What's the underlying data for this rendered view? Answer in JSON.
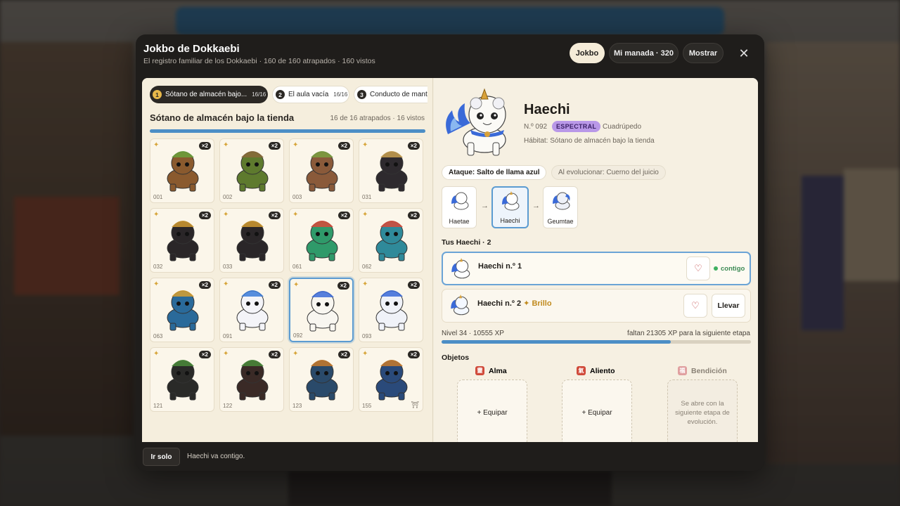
{
  "modal": {
    "title": "Jokbo de Dokkaebi",
    "subtitle": "El registro familiar de los Dokkaebi · 160 de 160 atrapados · 160 vistos",
    "buttons": {
      "jokbo": "Jokbo",
      "manada": "Mi manada · 320",
      "mostrar": "Mostrar"
    },
    "close_icon": "close-icon"
  },
  "tabs": [
    {
      "num": "1",
      "label": "Sótano de almacén bajo...",
      "count": "16/16"
    },
    {
      "num": "2",
      "label": "El aula vacía",
      "count": "16/16"
    },
    {
      "num": "3",
      "label": "Conducto de mant",
      "count": ""
    }
  ],
  "area": {
    "title": "Sótano de almacén bajo la tienda",
    "count": "16 de 16 atrapados · 16 vistos",
    "progress": 1.0
  },
  "creatures": [
    {
      "no": "001",
      "badge": "×2",
      "color": "#8a5a2e",
      "accent": "#6aa13a"
    },
    {
      "no": "002",
      "badge": "×2",
      "color": "#5e7a2e",
      "accent": "#8a6a3a"
    },
    {
      "no": "003",
      "badge": "×2",
      "color": "#8a5a3a",
      "accent": "#7aa040"
    },
    {
      "no": "031",
      "badge": "×2",
      "color": "#2e2a2e",
      "accent": "#c8a050"
    },
    {
      "no": "032",
      "badge": "×2",
      "color": "#2a2628",
      "accent": "#d09a30"
    },
    {
      "no": "033",
      "badge": "×2",
      "color": "#2a2628",
      "accent": "#d09a30"
    },
    {
      "no": "061",
      "badge": "×2",
      "color": "#2f9a6a",
      "accent": "#d84a3a"
    },
    {
      "no": "062",
      "badge": "×2",
      "color": "#2f8a9a",
      "accent": "#d84a3a"
    },
    {
      "no": "063",
      "badge": "×2",
      "color": "#2a6a9a",
      "accent": "#d8a030"
    },
    {
      "no": "091",
      "badge": "×2",
      "color": "#f4f4f8",
      "accent": "#3a7ad8"
    },
    {
      "no": "092",
      "badge": "×2",
      "color": "#f8f6f0",
      "accent": "#3a6ad8"
    },
    {
      "no": "093",
      "badge": "×2",
      "color": "#f0f2f8",
      "accent": "#3a6ad8"
    },
    {
      "no": "121",
      "badge": "×2",
      "color": "#2a2a28",
      "accent": "#4a8a3a"
    },
    {
      "no": "122",
      "badge": "×2",
      "color": "#3a2a26",
      "accent": "#4a8a3a"
    },
    {
      "no": "123",
      "badge": "×2",
      "color": "#2a4a6a",
      "accent": "#c87a2a"
    },
    {
      "no": "155",
      "badge": "×2",
      "color": "#2a4a7a",
      "accent": "#c87a2a",
      "gate": "⛩"
    }
  ],
  "detail": {
    "name": "Haechi",
    "number": "N.º 092",
    "rarity": "ESPECTRAL",
    "kind": "Cuadrúpedo",
    "habitat": "Hábitat: Sótano de almacén bajo la tienda",
    "attack": "Ataque: Salto de llama azul",
    "evolve": "Al evolucionar: Cuerno del juicio",
    "evolution": [
      {
        "label": "Haetae"
      },
      {
        "label": "Haechi"
      },
      {
        "label": "Geumtae"
      }
    ],
    "yours_title": "Tus Haechi · 2",
    "owned": [
      {
        "name": "Haechi n.º 1",
        "status": "contigo"
      },
      {
        "name": "Haechi n.º 2",
        "shine": "✦ Brillo",
        "action": "Llevar"
      }
    ],
    "level": "Nivel 34 · 10555 XP",
    "xp_left": "faltan 21305 XP para la siguiente etapa",
    "xp_progress": 0.74,
    "objects_title": "Objetos",
    "slots": [
      {
        "label": "Alma",
        "icon": "soul-icon",
        "action": "+ Equipar",
        "color": "#d04a3a"
      },
      {
        "label": "Aliento",
        "icon": "breath-icon",
        "action": "+ Equipar",
        "color": "#d04a3a"
      },
      {
        "label": "Bendición",
        "icon": "blessing-icon",
        "locked_text": "Se abre con la siguiente etapa de evolución.",
        "color": "#e0a0a0"
      }
    ]
  },
  "footer": {
    "solo": "Ir solo",
    "message": "Haechi va contigo."
  },
  "colors": {
    "accent": "#4c8ec6",
    "spectral": "#b998e8",
    "dark": "#1f1d1b"
  }
}
